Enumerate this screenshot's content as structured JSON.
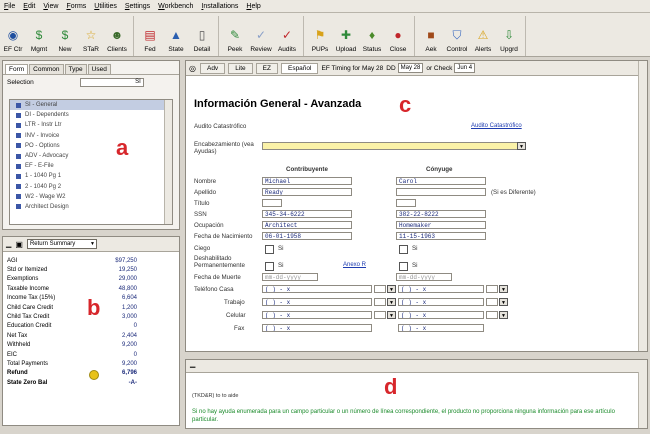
{
  "menu": [
    "File",
    "Edit",
    "View",
    "Forms",
    "Utilities",
    "Settings",
    "Workbench",
    "Installations",
    "Help"
  ],
  "toolbar": {
    "groups": [
      [
        {
          "label": "EF Ctr",
          "icon": "ef-center-icon",
          "glyph": "◉",
          "color": "#1f4fa0"
        },
        {
          "label": "Mgmt",
          "icon": "management-icon",
          "glyph": "$",
          "color": "#2f8a3a"
        },
        {
          "label": "New",
          "icon": "new-return-icon",
          "glyph": "$",
          "color": "#2f8a3a"
        },
        {
          "label": "STaR",
          "icon": "star-icon",
          "glyph": "☆",
          "color": "#d8a21a"
        },
        {
          "label": "Clients",
          "icon": "clients-icon",
          "glyph": "☻",
          "color": "#3a6a2a"
        }
      ],
      [
        {
          "label": "Fed",
          "icon": "federal-flag-icon",
          "glyph": "▤",
          "color": "#c0262b"
        },
        {
          "label": "State",
          "icon": "state-icon",
          "glyph": "▲",
          "color": "#2a5fb0"
        },
        {
          "label": "Detail",
          "icon": "detail-icon",
          "glyph": "▯",
          "color": "#555555"
        }
      ],
      [
        {
          "label": "Peek",
          "icon": "peek-icon",
          "glyph": "✎",
          "color": "#2f8a3a"
        },
        {
          "label": "Review",
          "icon": "review-icon",
          "glyph": "✓",
          "color": "#8aa0c8"
        },
        {
          "label": "Audits",
          "icon": "audits-icon",
          "glyph": "✓",
          "color": "#c0262b"
        }
      ],
      [
        {
          "label": "PUPs",
          "icon": "pups-icon",
          "glyph": "⚑",
          "color": "#d8a21a"
        },
        {
          "label": "Upload",
          "icon": "upload-icon",
          "glyph": "✚",
          "color": "#2f8a3a"
        },
        {
          "label": "Status",
          "icon": "status-icon",
          "glyph": "♦",
          "color": "#4a8a2a"
        },
        {
          "label": "Close",
          "icon": "close-icon",
          "glyph": "●",
          "color": "#c0262b"
        }
      ],
      [
        {
          "label": "Aek",
          "icon": "ask-icon",
          "glyph": "■",
          "color": "#a04a1a"
        },
        {
          "label": "Control",
          "icon": "control-icon",
          "glyph": "⛉",
          "color": "#3a6ac0"
        },
        {
          "label": "Alerts",
          "icon": "alerts-icon",
          "glyph": "⚠",
          "color": "#d8a21a"
        },
        {
          "label": "Upgrd",
          "icon": "upgrade-icon",
          "glyph": "⇩",
          "color": "#2f8a3a"
        }
      ]
    ]
  },
  "panel_a": {
    "letter": "a",
    "tabs": [
      "Form",
      "Common",
      "Type",
      "Used"
    ],
    "selection_label": "Selection",
    "selection_value": "SI",
    "items": [
      {
        "label": "SI - General",
        "selected": true
      },
      {
        "label": "DI - Dependents",
        "selected": false
      },
      {
        "label": "LTR - Instr Ltr",
        "selected": false
      },
      {
        "label": "INV - Invoice",
        "selected": false
      },
      {
        "label": "PO - Options",
        "selected": false
      },
      {
        "label": "ADV - Advocacy",
        "selected": false
      },
      {
        "label": "EF - E-File",
        "selected": false
      },
      {
        "label": "1 - 1040 Pg 1",
        "selected": false
      },
      {
        "label": "2 - 1040 Pg 2",
        "selected": false
      },
      {
        "label": "W2 - Wage W2",
        "selected": false
      },
      {
        "label": "Architect Design",
        "selected": false
      }
    ]
  },
  "panel_b": {
    "letter": "b",
    "dropdown": "Return Summary",
    "rows": [
      {
        "label": "AGI",
        "value": "$97,250",
        "bold": false
      },
      {
        "label": "Std or Itemized",
        "value": "19,250",
        "bold": false
      },
      {
        "label": "Exemptions",
        "value": "29,000",
        "bold": false
      },
      {
        "label": "Taxable Income",
        "value": "48,800",
        "bold": false
      },
      {
        "label": "Income Tax (15%)",
        "value": "6,604",
        "bold": false
      },
      {
        "label": "Child Care Credit",
        "value": "1,200",
        "bold": false
      },
      {
        "label": "Child Tax Credit",
        "value": "3,000",
        "bold": false
      },
      {
        "label": "Education Credit",
        "value": "0",
        "bold": false
      },
      {
        "label": "Net Tax",
        "value": "2,404",
        "bold": false
      },
      {
        "label": "Withheld",
        "value": "9,200",
        "bold": false
      },
      {
        "label": "EIC",
        "value": "0",
        "bold": false
      },
      {
        "label": "Total Payments",
        "value": "9,200",
        "bold": false
      },
      {
        "label": "Refund",
        "value": "6,796",
        "bold": true
      },
      {
        "label": "State Zero Bal",
        "value": "-A-",
        "bold": true
      }
    ]
  },
  "panel_c": {
    "letter": "c",
    "toolbar": {
      "btn_adv": "Adv",
      "btn_lite": "Lite",
      "btn_ez": "EZ",
      "btn_espanol": "Español",
      "timing_text": "EF Timing for May 28",
      "dd_label": "DD",
      "dd_value": "May 28",
      "check_label": "or Check",
      "check_value": "Jun 4"
    },
    "title": "Información General - Avanzada",
    "audit_label": "Audito Catastrófico",
    "audit_link": "Audito Catastrófico",
    "encab_label": "Encabezamiento (vea Ayudas)",
    "col_taxpayer": "Contribuyente",
    "col_spouse": "Cónyuge",
    "taxpayer": {
      "first_name": "Michael",
      "last_name": "Ready",
      "ssn": "345-34-6222",
      "occupation": "Architect",
      "dob": "06-01-1958",
      "death_date": "mm-dd-yyyy"
    },
    "spouse": {
      "first_name": "Carol",
      "last_name": "",
      "ssn": "382-22-8222",
      "occupation": "Homemaker",
      "dob": "11-15-1963",
      "death_date": "mm-dd-yyyy"
    },
    "if_different": "(Si es Diferente)",
    "labels": {
      "name": "Nombre",
      "last": "Apellido",
      "title": "Título",
      "ssn": "SSN",
      "occupation": "Ocupación",
      "dob": "Fecha de Nacimiento",
      "blind": "Ciego",
      "disabled": "Deshabilitado Permanentemente",
      "death": "Fecha de Muerte",
      "phone": "Teléfono  Casa",
      "work": "Trabajo",
      "cell": "Celular",
      "fax": "Fax"
    },
    "si": "Si",
    "annex_link": "Anexo R",
    "phone_mask": "(   )    -    x"
  },
  "panel_d": {
    "letter": "d",
    "small_text": "(TKD&R) to to aide",
    "help_text": "Si no hay ayuda enumerada para un campo particular o un número de línea correspondiente, el producto no proporciona ninguna información para ese artículo particular."
  }
}
